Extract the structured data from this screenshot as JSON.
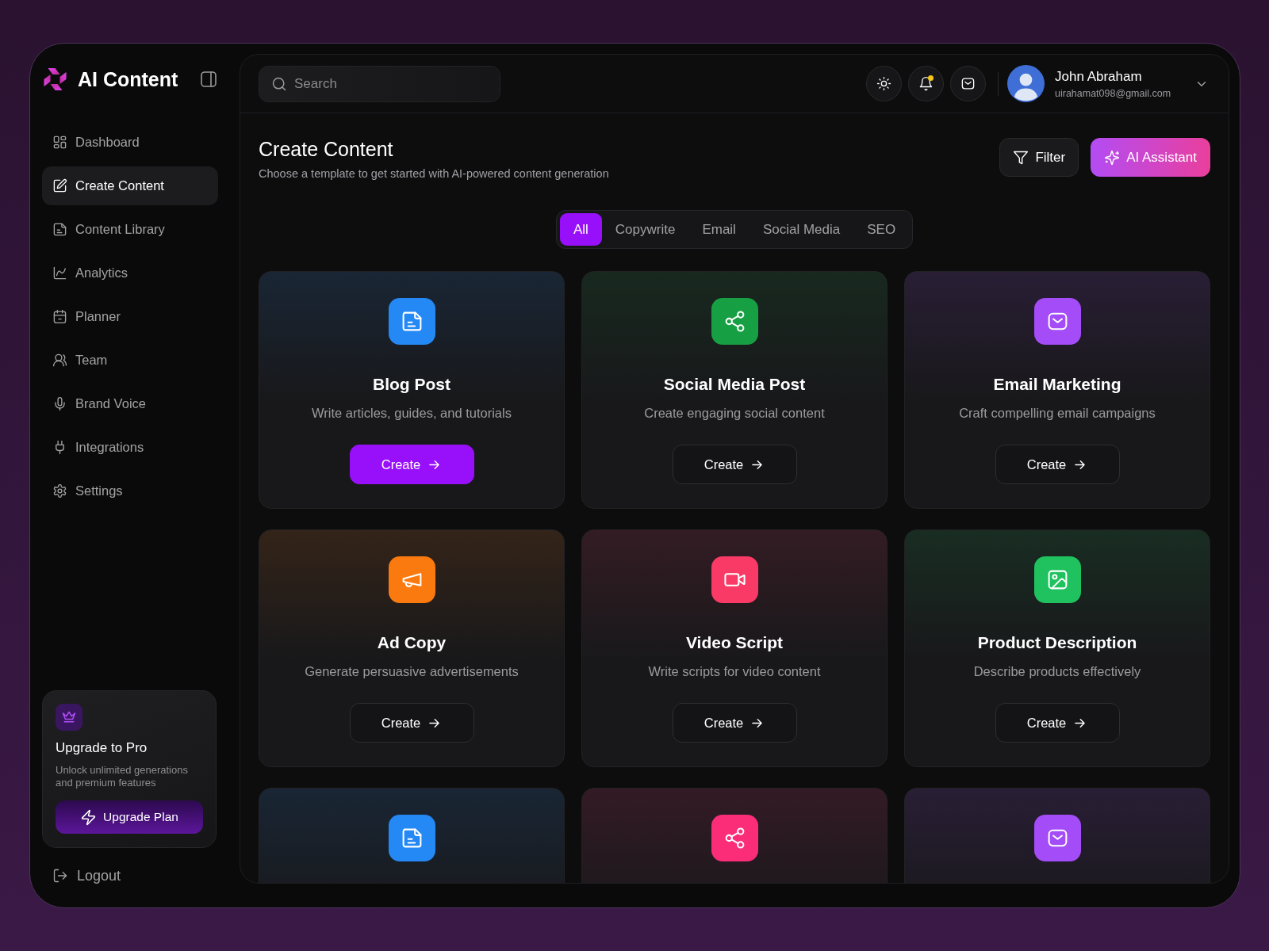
{
  "app": {
    "name": "AI Content"
  },
  "sidebar": {
    "items": [
      {
        "label": "Dashboard",
        "kind": "dashboard",
        "selected": false
      },
      {
        "label": "Create Content",
        "kind": "create",
        "selected": true
      },
      {
        "label": "Content Library",
        "kind": "library",
        "selected": false
      },
      {
        "label": "Analytics",
        "kind": "analytics",
        "selected": false
      },
      {
        "label": "Planner",
        "kind": "planner",
        "selected": false
      },
      {
        "label": "Team",
        "kind": "team",
        "selected": false
      },
      {
        "label": "Brand Voice",
        "kind": "voice",
        "selected": false
      },
      {
        "label": "Integrations",
        "kind": "integrations",
        "selected": false
      },
      {
        "label": "Settings",
        "kind": "settings",
        "selected": false
      }
    ],
    "upgrade": {
      "title": "Upgrade to Pro",
      "description": "Unlock unlimited generations and premium features",
      "button": "Upgrade Plan"
    },
    "logout": "Logout"
  },
  "header": {
    "search": {
      "placeholder": "Search"
    },
    "actions": [
      {
        "kind": "theme",
        "unread": false
      },
      {
        "kind": "notifications",
        "unread": true
      },
      {
        "kind": "messages",
        "unread": false
      }
    ],
    "user": {
      "name": "John Abraham",
      "email": "uirahamat098@gmail.com"
    }
  },
  "page": {
    "title": "Create Content",
    "subtitle": "Choose a template to get started with AI-powered content generation",
    "buttons": [
      {
        "kind": "filter",
        "label": "Filter"
      },
      {
        "kind": "assistant",
        "label": "AI Assistant"
      }
    ]
  },
  "tabs": [
    {
      "label": "All",
      "selected": true
    },
    {
      "label": "Copywrite",
      "selected": false
    },
    {
      "label": "Email",
      "selected": false
    },
    {
      "label": "Social Media",
      "selected": false
    },
    {
      "label": "SEO",
      "selected": false
    }
  ],
  "templates": [
    {
      "kind": "blog",
      "title": "Blog Post",
      "description": "Write articles, guides, and tutorials",
      "button": "Create",
      "primary": true,
      "color": "#2589f5"
    },
    {
      "kind": "social",
      "title": "Social Media Post",
      "description": "Create engaging social content",
      "button": "Create",
      "primary": false,
      "color": "#17a043"
    },
    {
      "kind": "email",
      "title": "Email Marketing",
      "description": "Craft compelling email campaigns",
      "button": "Create",
      "primary": false,
      "color": "#a34cf7"
    },
    {
      "kind": "ad",
      "title": "Ad Copy",
      "description": "Generate persuasive advertisements",
      "button": "Create",
      "primary": false,
      "color": "#fb7a0f"
    },
    {
      "kind": "video",
      "title": "Video Script",
      "description": "Write scripts for video content",
      "button": "Create",
      "primary": false,
      "color": "#f93a66"
    },
    {
      "kind": "product",
      "title": "Product Description",
      "description": "Describe products effectively",
      "button": "Create",
      "primary": false,
      "color": "#1fc25e"
    },
    {
      "kind": "blog",
      "color": "#2589f5"
    },
    {
      "kind": "social",
      "color": "#fb2d78"
    },
    {
      "kind": "email",
      "color": "#a34cf7"
    }
  ]
}
